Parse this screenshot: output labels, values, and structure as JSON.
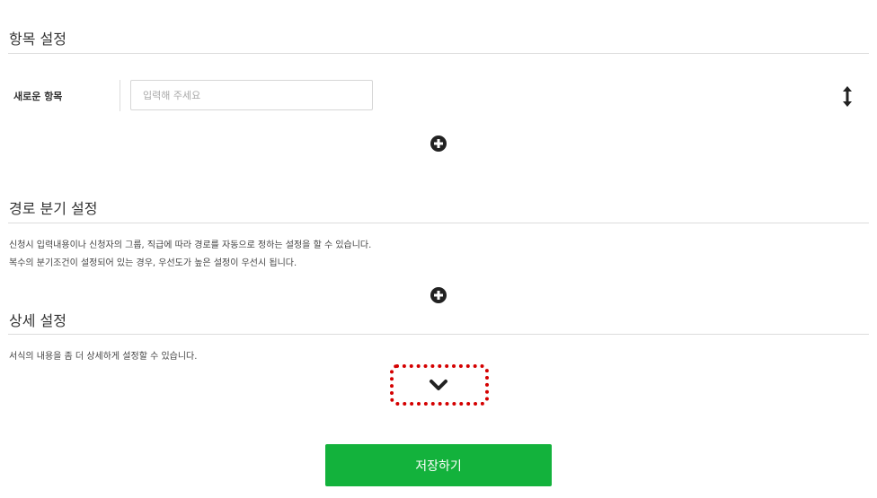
{
  "sections": {
    "items": {
      "title": "항목 설정",
      "row": {
        "label": "새로운 항목",
        "input_placeholder": "입력해 주세요",
        "input_value": ""
      }
    },
    "routing": {
      "title": "경로 분기 설정",
      "desc_line1": "신청시 입력내용이나 신청자의 그룹, 직급에 따라 경로를 자동으로 정하는 설정을 할 수 있습니다.",
      "desc_line2": "복수의 분기조건이 설정되어 있는 경우, 우선도가 높은 설정이 우선시 됩니다."
    },
    "details": {
      "title": "상세 설정",
      "desc": "서식의 내용을 좀 더 상세하게 설정할 수 있습니다."
    }
  },
  "icons": {
    "drag": "up-down-arrow-icon",
    "add": "plus-circle-icon",
    "expand": "chevron-down-icon"
  },
  "colors": {
    "primary": "#13b23c",
    "highlight": "#d40000",
    "icon": "#222222"
  },
  "footer": {
    "save_label": "저장하기"
  }
}
